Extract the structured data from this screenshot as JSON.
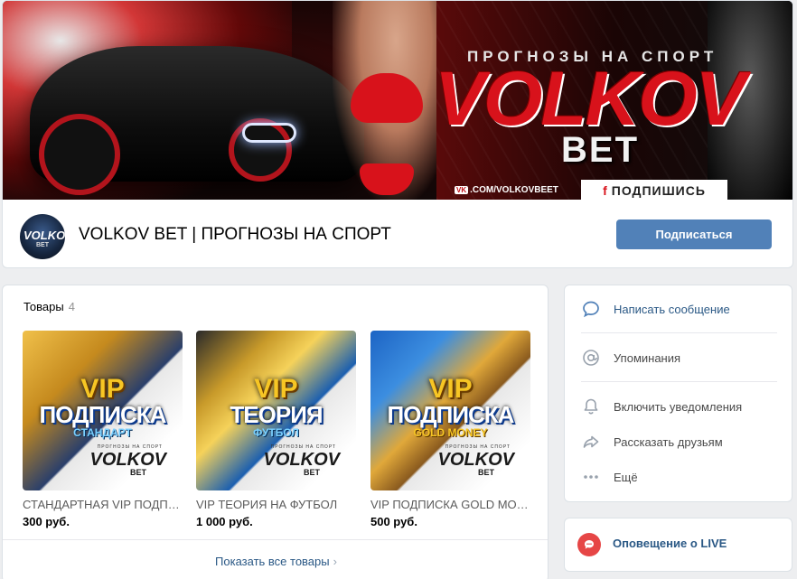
{
  "cover": {
    "subtitle": "ПРОГНОЗЫ НА СПОРТ",
    "brand_main": "VOLKOV",
    "brand_sub": "BET",
    "url": ".COM/VOLKOVBEET",
    "url_prefix": "VK",
    "subscribe_badge": "ПОДПИШИСЬ",
    "badge_mark": "f"
  },
  "group": {
    "avatar_text": "VOLKOV",
    "avatar_sub": "BET",
    "title": "VOLKOV BET | ПРОГНОЗЫ НА СПОРТ",
    "subscribe_label": "Подписаться"
  },
  "goods": {
    "heading": "Товары",
    "count": "4",
    "show_all": "Показать все товары",
    "items": [
      {
        "vip": "VIP",
        "big": "ПОДПИСКА",
        "small": "СТАНДАРТ",
        "brand_top": "ПРОГНОЗЫ НА СПОРТ",
        "brand": "VOLKOV",
        "brand_sub": "BET",
        "name": "СТАНДАРТНАЯ VIP ПОДПИСКА",
        "price": "300 руб."
      },
      {
        "vip": "VIP",
        "big": "ТЕОРИЯ",
        "small": "ФУТБОЛ",
        "brand_top": "ПРОГНОЗЫ НА СПОРТ",
        "brand": "VOLKOV",
        "brand_sub": "BET",
        "name": "VIP ТЕОРИЯ НА ФУТБОЛ",
        "price": "1 000 руб."
      },
      {
        "vip": "VIP",
        "big": "ПОДПИСКА",
        "small": "GOLD MONEY",
        "brand_top": "ПРОГНОЗЫ НА СПОРТ",
        "brand": "VOLKOV",
        "brand_sub": "BET",
        "name": "VIP ПОДПИСКА GOLD MONEY",
        "price": "500 руб."
      }
    ]
  },
  "menu": {
    "items": [
      {
        "label": "Написать сообщение",
        "icon": "message-icon"
      },
      {
        "label": "Упоминания",
        "icon": "at-icon"
      },
      {
        "label": "Включить уведомления",
        "icon": "bell-icon"
      },
      {
        "label": "Рассказать друзьям",
        "icon": "share-icon"
      },
      {
        "label": "Ещё",
        "icon": "more-icon"
      }
    ]
  },
  "live": {
    "label": "Оповещение о LIVE",
    "icon": "live-icon"
  },
  "colors": {
    "accent": "#5181b8",
    "link": "#2a5885",
    "brand_red": "#d8121b",
    "live": "#e64646"
  }
}
